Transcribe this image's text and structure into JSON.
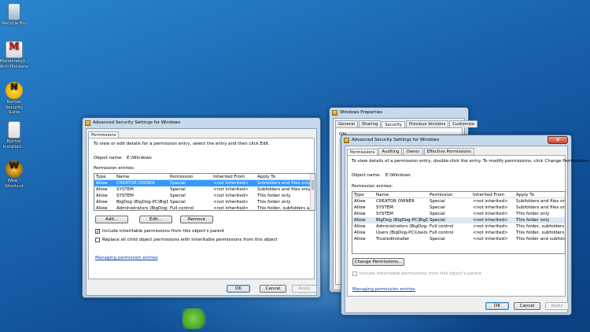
{
  "desktop": {
    "icons": [
      {
        "label": "Recycle Bin"
      },
      {
        "label": "Malwarebyt... Anti-Malware"
      },
      {
        "label": "Norton Security Suite"
      },
      {
        "label": "Norton Installati..."
      },
      {
        "label": "Wow - Shortcut"
      }
    ]
  },
  "winA": {
    "title": "Advanced Security Settings for Windows",
    "tab": "Permissions",
    "intro": "To view or edit details for a permission entry, select the entry and then click Edit.",
    "object_label": "Object name:",
    "object_value": "E:\\Windows",
    "entries_label": "Permission entries:",
    "columns": [
      "Type",
      "Name",
      "Permission",
      "Inherited From",
      "Apply To"
    ],
    "rows": [
      [
        "Allow",
        "CREATOR OWNER",
        "Special",
        "<not inherited>",
        "Subfolders and files only"
      ],
      [
        "Allow",
        "SYSTEM",
        "Special",
        "<not inherited>",
        "Subfolders and files only"
      ],
      [
        "Allow",
        "SYSTEM",
        "Special",
        "<not inherited>",
        "This folder only"
      ],
      [
        "Allow",
        "BigDog (BigDog-PC\\BigDog)",
        "Special",
        "<not inherited>",
        "This folder only"
      ],
      [
        "Allow",
        "Administrators (BigDog-P...",
        "Full control",
        "<not inherited>",
        "This folder, subfolders a..."
      ]
    ],
    "add_label": "Add...",
    "edit_label": "Edit...",
    "remove_label": "Remove",
    "include_inheritable": "Include inheritable permissions from this object's parent",
    "replace_child": "Replace all child object permissions with inheritable permissions from this object",
    "managing_link": "Managing permission entries",
    "ok_label": "OK",
    "cancel_label": "Cancel",
    "apply_label": "Apply"
  },
  "winProps": {
    "title": "Windows Properties",
    "tabs": [
      "General",
      "Sharing",
      "Security",
      "Previous Versions",
      "Customize"
    ],
    "partial_text": "Obj"
  },
  "winB": {
    "title": "Advanced Security Settings for Windows",
    "tabs": [
      "Permissions",
      "Auditing",
      "Owner",
      "Effective Permissions"
    ],
    "intro": "To view details of a permission entry, double-click the entry. To modify permissions, click Change Permissions.",
    "object_label": "Object name:",
    "object_value": "E:\\Windows",
    "entries_label": "Permission entries:",
    "columns": [
      "Type",
      "Name",
      "Permission",
      "Inherited From",
      "Apply To"
    ],
    "rows": [
      [
        "Allow",
        "CREATOR OWNER",
        "Special",
        "<not inherited>",
        "Subfolders and files only"
      ],
      [
        "Allow",
        "SYSTEM",
        "Special",
        "<not inherited>",
        "Subfolders and files only"
      ],
      [
        "Allow",
        "SYSTEM",
        "Special",
        "<not inherited>",
        "This folder only"
      ],
      [
        "Allow",
        "BigDog (BigDog-PC\\BigD...",
        "Special",
        "<not inherited>",
        "This folder only"
      ],
      [
        "Allow",
        "Administrators (BigDog-Pc...",
        "Full control",
        "<not inherited>",
        "This folder, subfolders and..."
      ],
      [
        "Allow",
        "Users (BigDog-PC\\Users)",
        "Full control",
        "<not inherited>",
        "This folder, subfolders and..."
      ],
      [
        "Allow",
        "TrustedInstaller",
        "Special",
        "<not inherited>",
        "This folder and subfolders"
      ]
    ],
    "change_label": "Change Permissions...",
    "include_inheritable": "Include inheritable permissions from this object's parent",
    "managing_link": "Managing permission entries",
    "ok_label": "OK",
    "cancel_label": "Cancel",
    "apply_label": "Apply"
  }
}
